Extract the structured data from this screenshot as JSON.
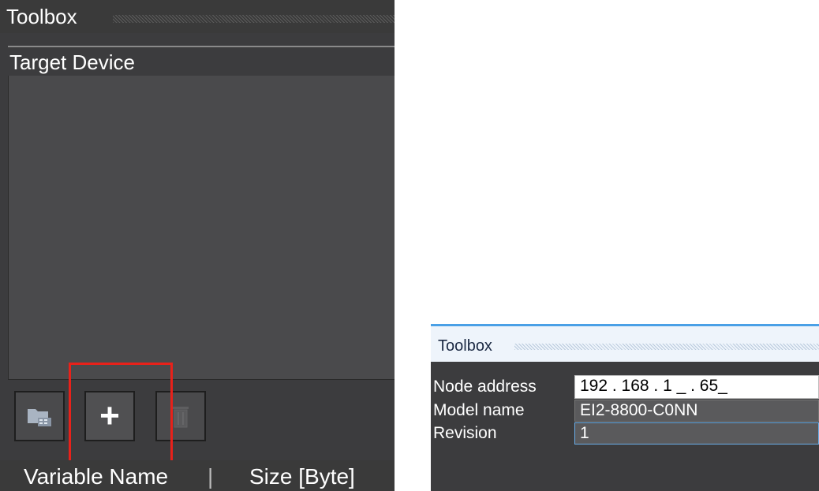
{
  "left_panel": {
    "toolbox_title": "Toolbox",
    "target_device_title": "Target Device",
    "buttons": {
      "folder_icon": "folder-icon",
      "add_label": "+",
      "delete_icon": "trash-icon"
    },
    "columns": {
      "variable_name": "Variable Name",
      "separator": "|",
      "size": "Size [Byte]"
    },
    "highlight_color": "#e8211a"
  },
  "right_panel": {
    "toolbox_title": "Toolbox",
    "properties": {
      "node_address_label": "Node address",
      "node_address_value": "192 . 168 . 1 _ . 65_",
      "model_name_label": "Model name",
      "model_name_value": "EI2-8800-C0NN",
      "revision_label": "Revision",
      "revision_value": "1"
    },
    "accent_color": "#4aa0e6"
  }
}
